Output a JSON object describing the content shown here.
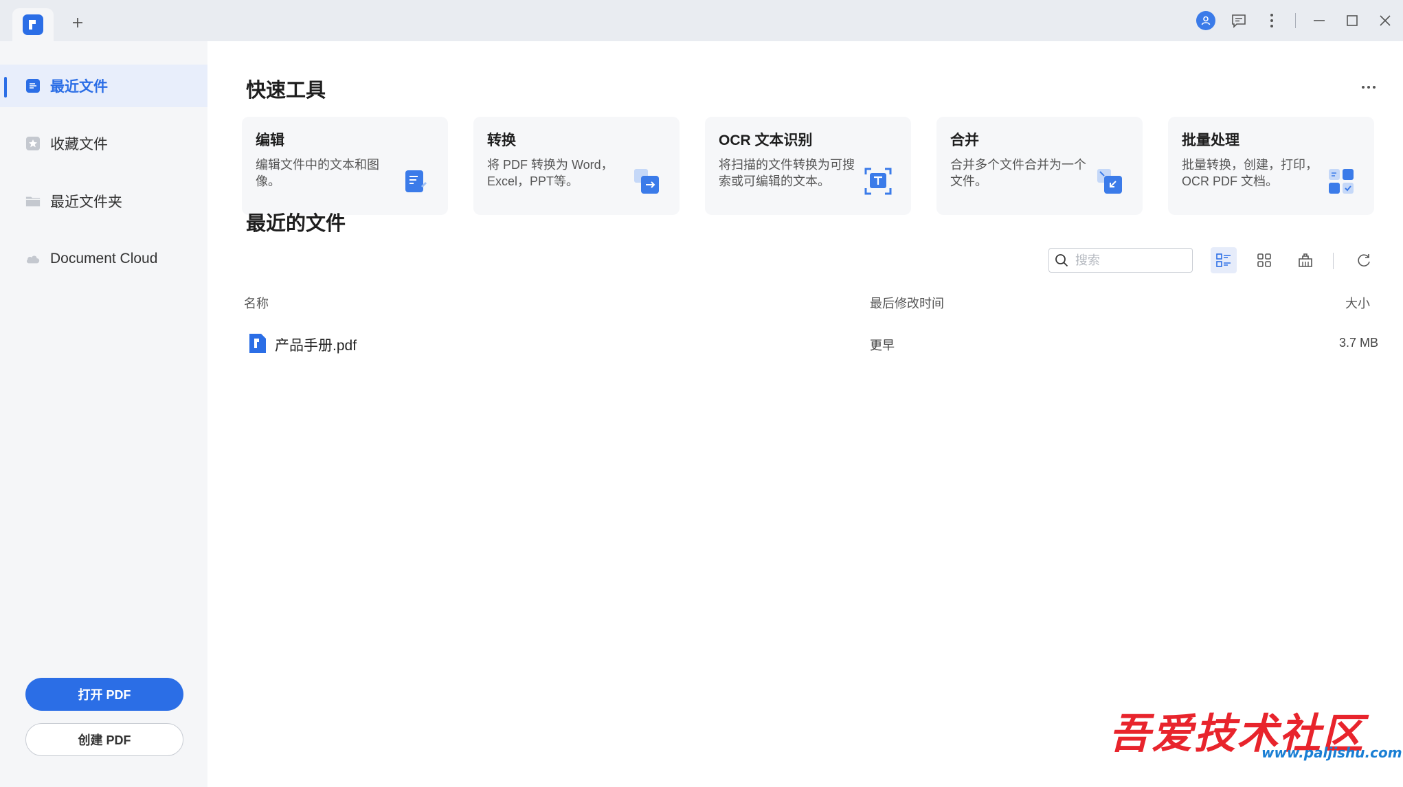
{
  "titlebar": {
    "new_tab_label": "+",
    "icons": [
      "app-logo-icon",
      "user-icon",
      "comment-icon",
      "more-vertical-icon",
      "minimize-icon",
      "maximize-icon",
      "close-icon"
    ]
  },
  "sidebar": {
    "items": [
      {
        "label": "最近文件",
        "icon": "recent-file-icon",
        "active": true
      },
      {
        "label": "收藏文件",
        "icon": "star-file-icon",
        "active": false
      },
      {
        "label": "最近文件夹",
        "icon": "folder-icon",
        "active": false
      },
      {
        "label": "Document Cloud",
        "icon": "cloud-icon",
        "active": false
      }
    ],
    "open_pdf_label": "打开 PDF",
    "create_pdf_label": "创建 PDF"
  },
  "quick_tools": {
    "title": "快速工具",
    "more_label": "···",
    "cards": [
      {
        "title": "编辑",
        "desc": "编辑文件中的文本和图像。",
        "icon": "edit-doc-icon"
      },
      {
        "title": "转换",
        "desc": "将 PDF 转换为 Word，Excel，PPT等。",
        "icon": "convert-icon"
      },
      {
        "title": "OCR 文本识别",
        "desc": "将扫描的文件转换为可搜索或可编辑的文本。",
        "icon": "ocr-scan-icon"
      },
      {
        "title": "合并",
        "desc": "合并多个文件合并为一个文件。",
        "icon": "merge-icon"
      },
      {
        "title": "批量处理",
        "desc": "批量转换，创建，打印，OCR PDF 文档。",
        "icon": "batch-icon"
      }
    ]
  },
  "recent_files": {
    "title": "最近的文件",
    "search_placeholder": "搜索",
    "columns": {
      "name": "名称",
      "modified": "最后修改时间",
      "size": "大小"
    },
    "rows": [
      {
        "name": "产品手册.pdf",
        "modified": "更早",
        "size": "3.7 MB"
      }
    ],
    "view_mode": "list"
  },
  "watermark": {
    "title": "吾爱技术社区",
    "url": "www.paljishu.com"
  },
  "colors": {
    "accent": "#2b6ee6",
    "sidebar_bg": "#f5f6f8",
    "titlebar_bg": "#e9ecf1",
    "card_bg": "#f6f7f9"
  }
}
